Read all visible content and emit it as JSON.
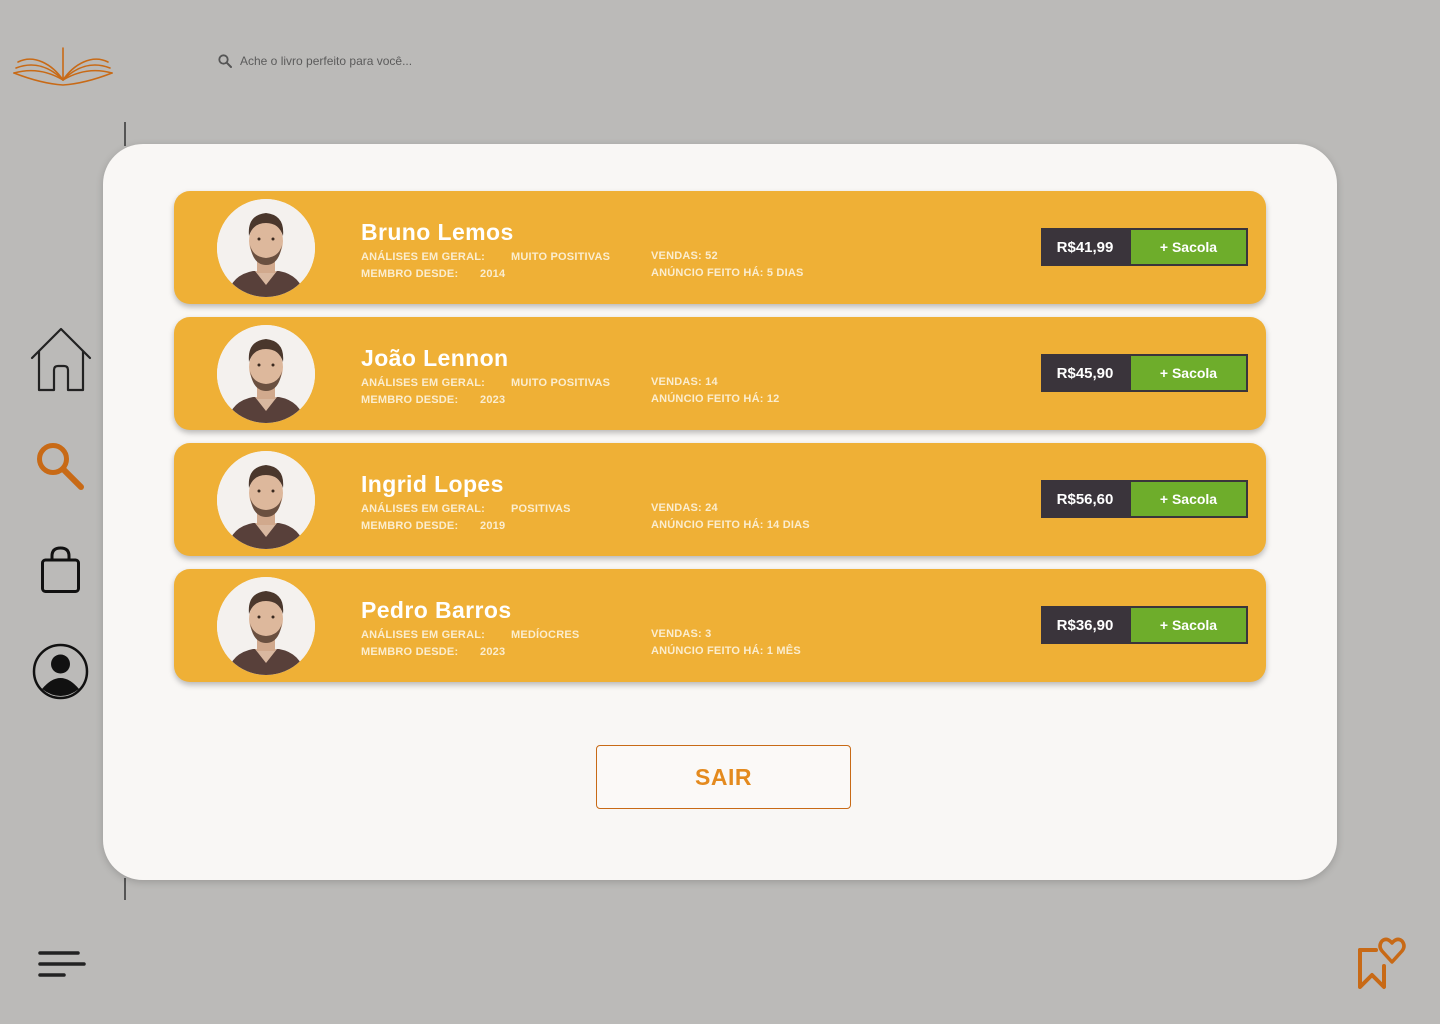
{
  "search": {
    "placeholder": "Ache o livro perfeito para você..."
  },
  "labels": {
    "reviews": "ANÁLISES EM GERAL:",
    "member_since": "MEMBRO DESDE:",
    "sales": "VENDAS:",
    "ad_made": "ANÚNCIO FEITO HÁ:",
    "add_to_bag": "+ Sacola"
  },
  "sellers": [
    {
      "name": "Bruno Lemos",
      "reviews": "MUITO POSITIVAS",
      "member_since": "2014",
      "sales": "52",
      "ad_age": "5 DIAS",
      "price": "R$41,99"
    },
    {
      "name": "João Lennon",
      "reviews": "MUITO POSITIVAS",
      "member_since": "2023",
      "sales": "14",
      "ad_age": "12",
      "price": "R$45,90"
    },
    {
      "name": "Ingrid Lopes",
      "reviews": "POSITIVAS",
      "member_since": "2019",
      "sales": "24",
      "ad_age": "14 DIAS",
      "price": "R$56,60"
    },
    {
      "name": "Pedro Barros",
      "reviews": "MEDÍOCRES",
      "member_since": "2023",
      "sales": "3",
      "ad_age": "1 MÊS",
      "price": "R$36,90"
    }
  ],
  "exit_label": "SAIR",
  "colors": {
    "background": "#bbbab8",
    "panel": "#f9f7f5",
    "card": "#efb036",
    "price_bg": "#3a343b",
    "bag_button": "#6ead2b",
    "accent_orange": "#c86a16"
  },
  "icons": {
    "logo": "open-book-logo",
    "search": "search-icon",
    "nav": [
      "home-icon",
      "search-icon",
      "shopping-bag-icon",
      "user-icon",
      "menu-icon",
      "bookmark-heart-icon"
    ]
  }
}
